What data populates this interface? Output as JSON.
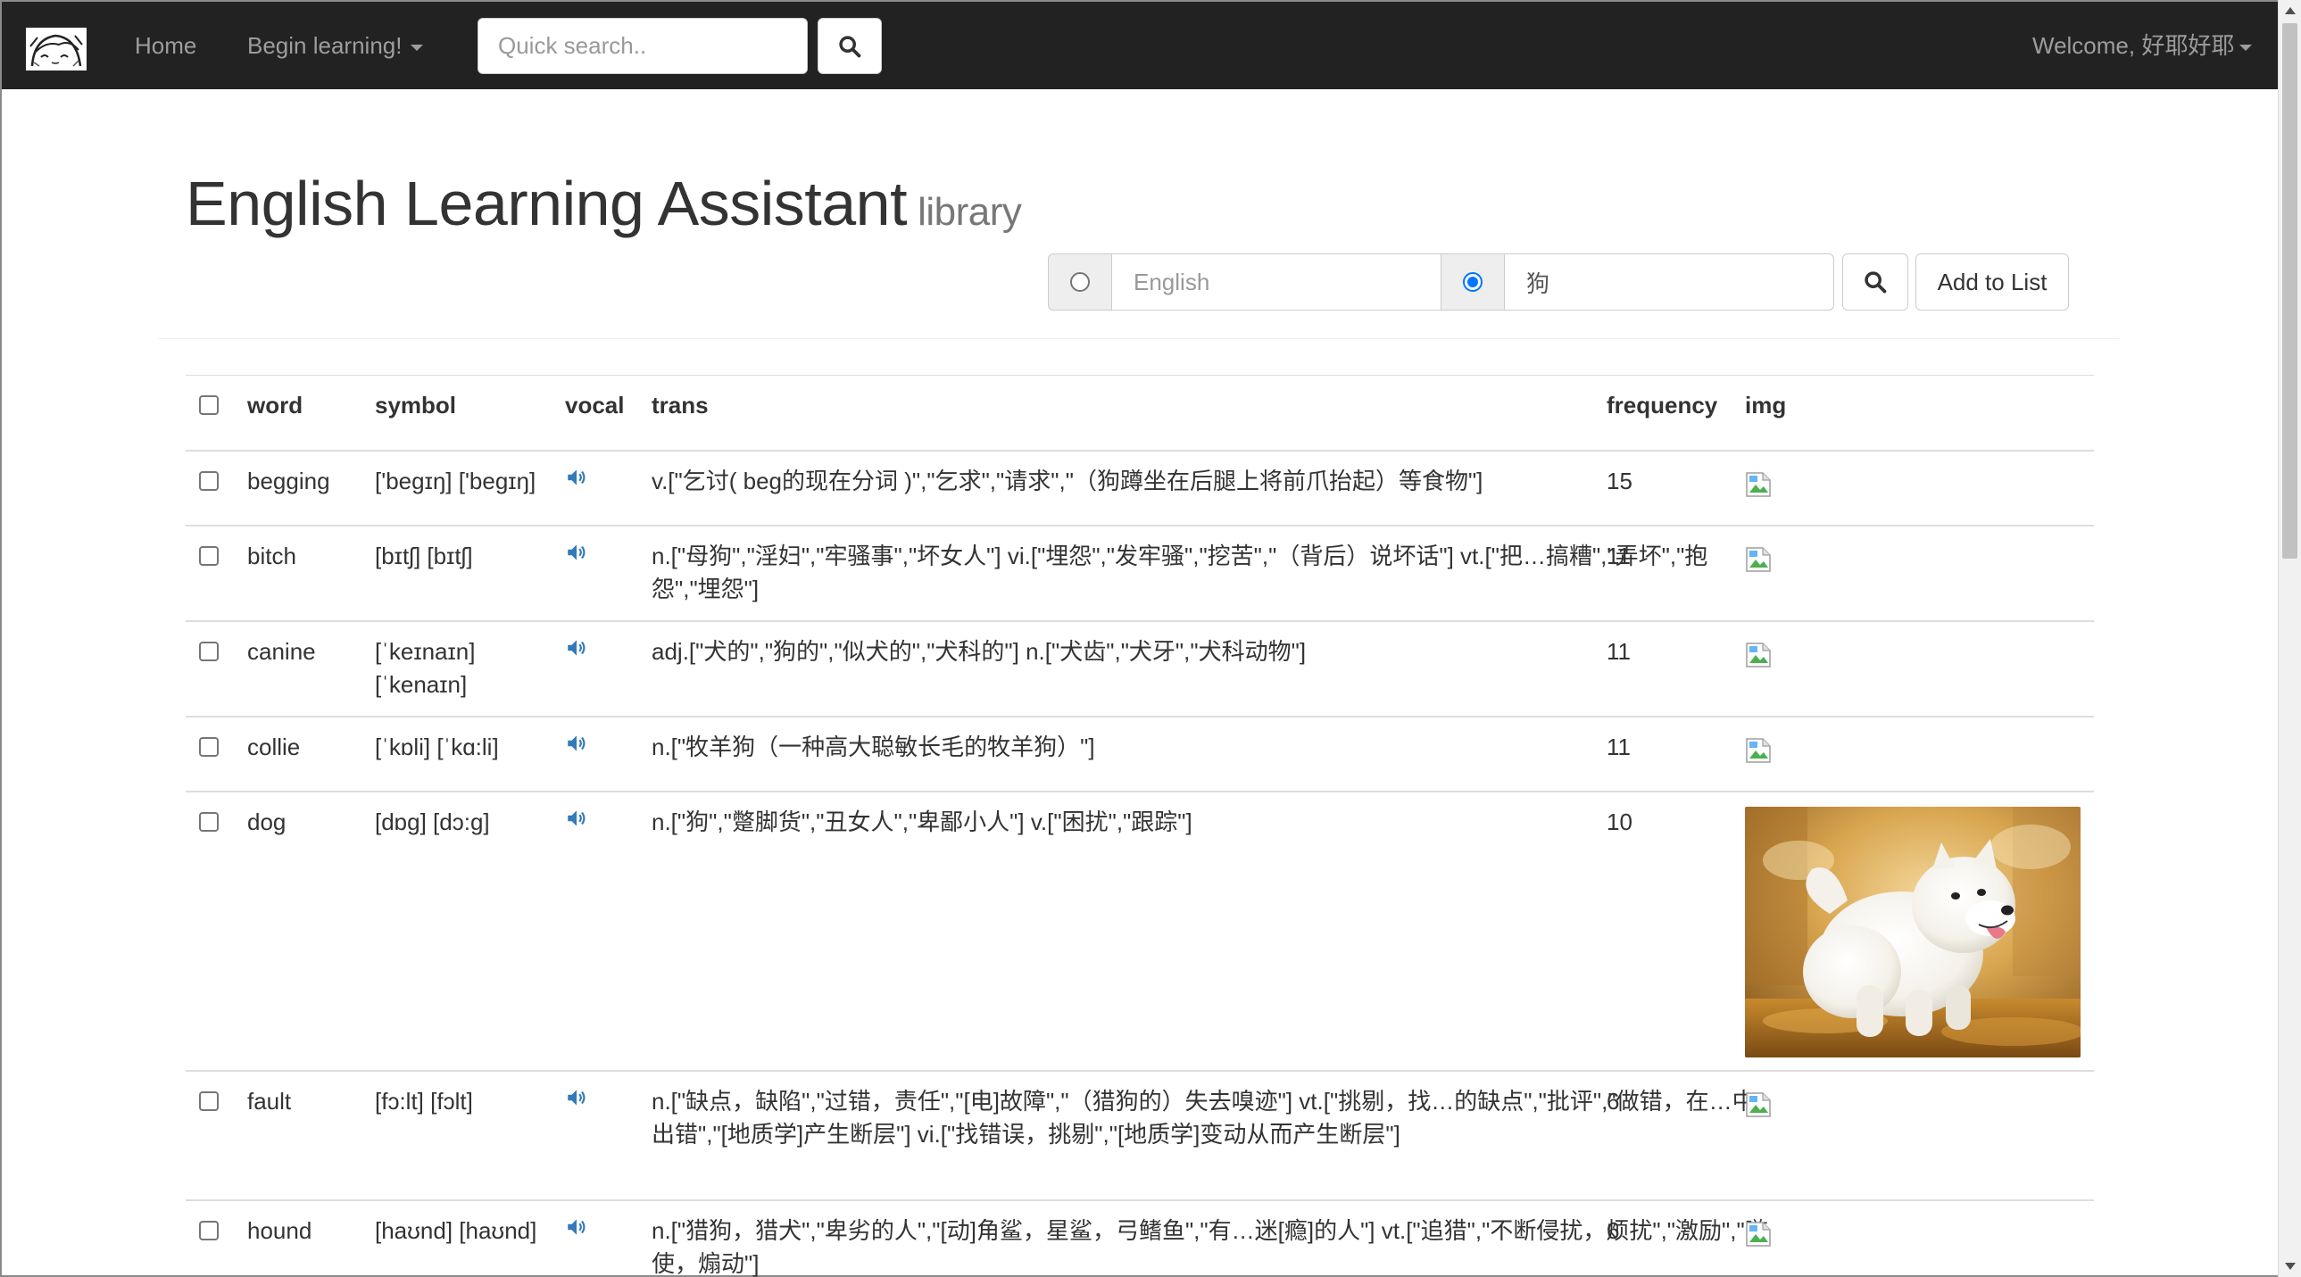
{
  "navbar": {
    "brand_icon": "anime-avatar-logo",
    "home_label": "Home",
    "learning_label": "Begin learning!",
    "quick_search_placeholder": "Quick search..",
    "search_icon": "search-icon",
    "welcome_label": "Welcome, 好耶好耶"
  },
  "header": {
    "title": "English Learning Assistant",
    "subtitle": "library"
  },
  "search": {
    "english_placeholder": "English",
    "english_selected": false,
    "chinese_value": "狗",
    "chinese_selected": true,
    "add_label": "Add to List"
  },
  "table": {
    "columns": [
      "word",
      "symbol",
      "vocal",
      "trans",
      "frequency",
      "img"
    ],
    "rows": [
      {
        "word": "begging",
        "symbol": "['begɪŋ] ['begɪŋ]",
        "trans": "v.[\"乞讨( beg的现在分词 )\",\"乞求\",\"请求\",\"（狗蹲坐在后腿上将前爪抬起）等食物\"]",
        "frequency": "15",
        "img": "broken"
      },
      {
        "word": "bitch",
        "symbol": "[bɪtʃ] [bɪtʃ]",
        "trans": "n.[\"母狗\",\"淫妇\",\"牢骚事\",\"坏女人\"] vi.[\"埋怨\",\"发牢骚\",\"挖苦\",\"（背后）说坏话\"] vt.[\"把…搞糟\",\"弄坏\",\"抱怨\",\"埋怨\"]",
        "frequency": "11",
        "img": "broken"
      },
      {
        "word": "canine",
        "symbol": "[ˈkeɪnaɪn] [ˈkenaɪn]",
        "trans": "adj.[\"犬的\",\"狗的\",\"似犬的\",\"犬科的\"] n.[\"犬齿\",\"犬牙\",\"犬科动物\"]",
        "frequency": "11",
        "img": "broken"
      },
      {
        "word": "collie",
        "symbol": "[ˈkɒli] [ˈkɑ:li]",
        "trans": "n.[\"牧羊狗（一种高大聪敏长毛的牧羊狗）\"]",
        "frequency": "11",
        "img": "broken"
      },
      {
        "word": "dog",
        "symbol": "[dɒg] [dɔ:g]",
        "trans": "n.[\"狗\",\"蹩脚货\",\"丑女人\",\"卑鄙小人\"] v.[\"困扰\",\"跟踪\"]",
        "frequency": "10",
        "img": "photo"
      },
      {
        "word": "fault",
        "symbol": "[fɔ:lt] [fɔlt]",
        "trans": "n.[\"缺点，缺陷\",\"过错，责任\",\"[电]故障\",\"（猎狗的）失去嗅迹\"] vt.[\"挑剔，找…的缺点\",\"批评\",\"做错，在…中出错\",\"[地质学]产生断层\"] vi.[\"找错误，挑剔\",\"[地质学]变动从而产生断层\"]",
        "frequency": "6",
        "img": "broken"
      },
      {
        "word": "hound",
        "symbol": "[haʊnd] [haʊnd]",
        "trans": "n.[\"猎狗，猎犬\",\"卑劣的人\",\"[动]角鲨，星鲨，弓鳍鱼\",\"有…迷[瘾]的人\"] vt.[\"追猎\",\"不断侵扰，烦扰\",\"激励\",\"嗾使，煽动\"]",
        "frequency": "6",
        "img": "broken"
      }
    ]
  },
  "icons": {
    "vocal": "speaker-icon",
    "img_missing": "broken-image-icon",
    "dog_photo": "white-samoyed-dog-photo"
  },
  "colors": {
    "navbar_bg": "#222222",
    "nav_text": "#9d9d9d",
    "accent": "#337ab7",
    "radio_blue": "#0075ff"
  }
}
